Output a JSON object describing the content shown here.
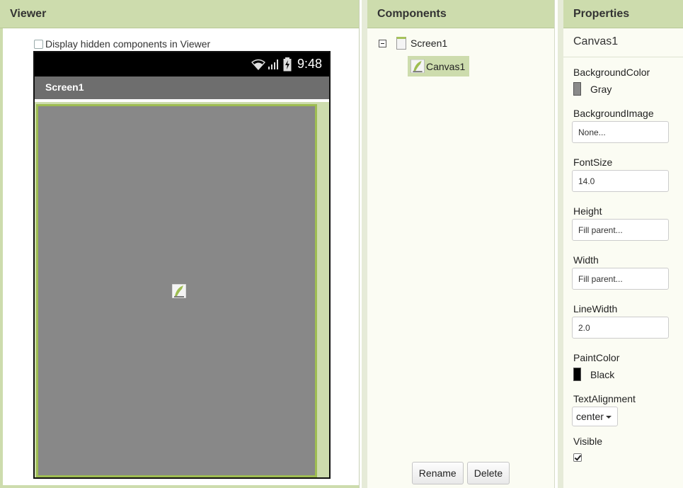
{
  "viewer": {
    "title": "Viewer",
    "hidden_components_label": "Display hidden components in Viewer",
    "hidden_components_checked": false,
    "status_time": "9:48",
    "screen_title": "Screen1",
    "canvas_color": "#888888"
  },
  "components": {
    "title": "Components",
    "tree": {
      "root": "Screen1",
      "children": [
        "Canvas1"
      ]
    },
    "rename_label": "Rename",
    "delete_label": "Delete"
  },
  "properties": {
    "title": "Properties",
    "selected_component": "Canvas1",
    "background_color": {
      "label": "BackgroundColor",
      "value": "Gray",
      "swatch": "#8a8a8a"
    },
    "background_image": {
      "label": "BackgroundImage",
      "value": "None..."
    },
    "font_size": {
      "label": "FontSize",
      "value": "14.0"
    },
    "height": {
      "label": "Height",
      "value": "Fill parent..."
    },
    "width": {
      "label": "Width",
      "value": "Fill parent..."
    },
    "line_width": {
      "label": "LineWidth",
      "value": "2.0"
    },
    "paint_color": {
      "label": "PaintColor",
      "value": "Black",
      "swatch": "#000000"
    },
    "text_alignment": {
      "label": "TextAlignment",
      "value": "center"
    },
    "visible": {
      "label": "Visible",
      "checked": true
    }
  },
  "colors": {
    "header_bg": "#cddcad",
    "accent_green": "#9ebd52",
    "panel_bg": "#fbfcf3"
  }
}
